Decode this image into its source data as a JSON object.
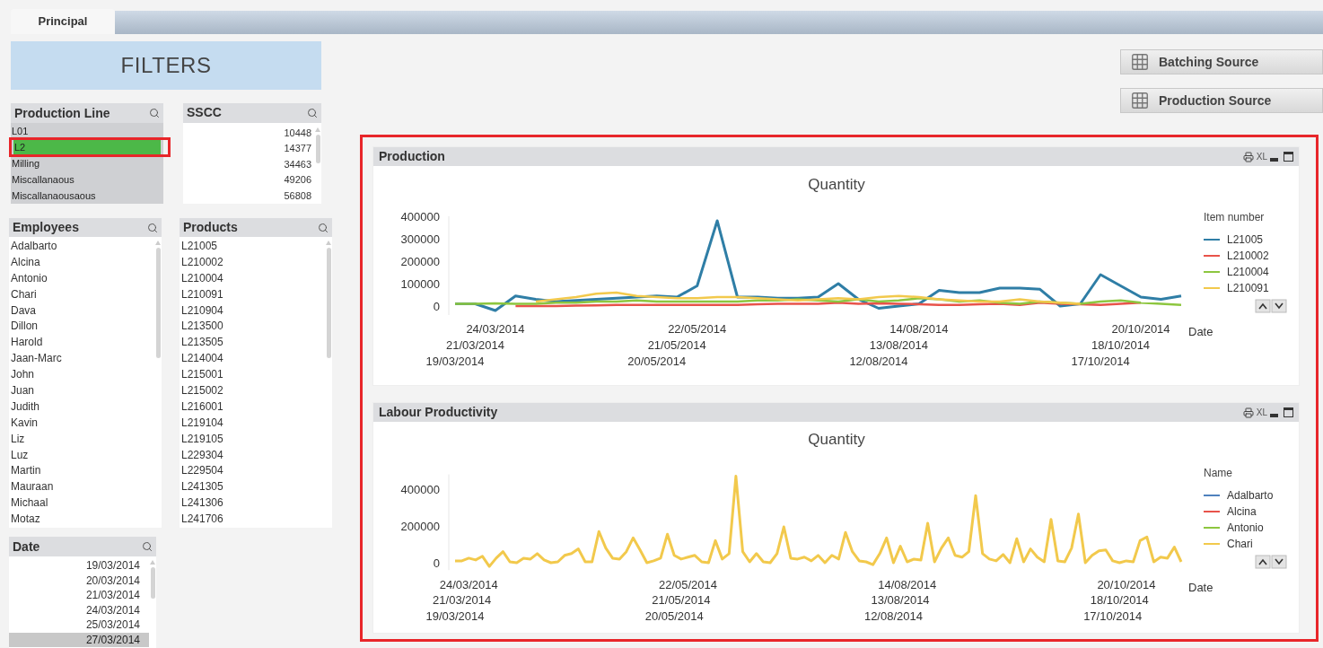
{
  "tabs": [
    {
      "label": "Principal",
      "selected": true
    }
  ],
  "filters_title": "FILTERS",
  "production_line": {
    "title": "Production Line",
    "items": [
      {
        "label": "L01",
        "selected": false
      },
      {
        "label": "L2",
        "selected": true
      },
      {
        "label": "Milling",
        "selected": false
      },
      {
        "label": "Miscallanaous",
        "selected": false
      },
      {
        "label": "Miscallanaousaous",
        "selected": false
      }
    ]
  },
  "sscc": {
    "title": "SSCC",
    "items": [
      "10448",
      "14377",
      "34463",
      "49206",
      "56808"
    ]
  },
  "employees": {
    "title": "Employees",
    "items": [
      "Adalbarto",
      "Alcina",
      "Antonio",
      "Chari",
      "Dava",
      "Dillon",
      "Harold",
      "Jaan-Marc",
      "John",
      "Juan",
      "Judith",
      "Kavin",
      "Liz",
      "Luz",
      "Martin",
      "Mauraan",
      "Michaal",
      "Motaz"
    ]
  },
  "products": {
    "title": "Products",
    "items": [
      "L21005",
      "L210002",
      "L210004",
      "L210091",
      "L210904",
      "L213500",
      "L213505",
      "L214004",
      "L215001",
      "L215002",
      "L216001",
      "L219104",
      "L219105",
      "L229304",
      "L229504",
      "L241305",
      "L241306",
      "L241706"
    ]
  },
  "date_list": {
    "title": "Date",
    "items": [
      {
        "label": "19/03/2014",
        "excluded": false
      },
      {
        "label": "20/03/2014",
        "excluded": false
      },
      {
        "label": "21/03/2014",
        "excluded": false
      },
      {
        "label": "24/03/2014",
        "excluded": false
      },
      {
        "label": "25/03/2014",
        "excluded": false
      },
      {
        "label": "27/03/2014",
        "excluded": true
      }
    ]
  },
  "source_buttons": [
    "Batching Source",
    "Production Source"
  ],
  "charts": [
    {
      "title": "Production",
      "tools": [
        "XL"
      ],
      "chart_data": {
        "type": "line",
        "title": "Quantity",
        "xlabel": "Date",
        "legend": {
          "title": "Item number"
        },
        "ylim": [
          -40000,
          400000
        ],
        "yticks": [
          0,
          100000,
          200000,
          300000,
          400000
        ],
        "categories": [
          "19/03/2014",
          "21/03/2014",
          "24/03/2014",
          null,
          null,
          null,
          null,
          null,
          null,
          null,
          "20/05/2014",
          "21/05/2014",
          "22/05/2014",
          null,
          null,
          null,
          null,
          null,
          null,
          null,
          null,
          "12/08/2014",
          "13/08/2014",
          "14/08/2014",
          null,
          null,
          null,
          null,
          null,
          null,
          null,
          null,
          "17/10/2014",
          "18/10/2014",
          "20/10/2014",
          null,
          null
        ],
        "series": [
          {
            "name": "L21005",
            "color": "#2f7ea6",
            "values": [
              10000,
              10000,
              -20000,
              45000,
              30000,
              20000,
              25000,
              30000,
              35000,
              40000,
              45000,
              40000,
              90000,
              380000,
              40000,
              40000,
              35000,
              35000,
              40000,
              100000,
              30000,
              -10000,
              0,
              10000,
              70000,
              60000,
              60000,
              80000,
              80000,
              75000,
              0,
              10000,
              140000,
              90000,
              40000,
              30000,
              45000
            ]
          },
          {
            "name": "L210002",
            "color": "#e8534a",
            "values": [
              null,
              null,
              null,
              0,
              0,
              0,
              2000,
              3000,
              5000,
              5000,
              5000,
              5000,
              5000,
              5000,
              5000,
              8000,
              10000,
              10000,
              10000,
              15000,
              10000,
              12000,
              10000,
              8000,
              5000,
              5000,
              8000,
              10000,
              5000,
              15000,
              10000,
              8000,
              5000,
              10000,
              15000,
              null,
              null
            ]
          },
          {
            "name": "L210004",
            "color": "#8dc63f",
            "values": [
              10000,
              10000,
              12000,
              10000,
              10000,
              15000,
              15000,
              20000,
              20000,
              25000,
              20000,
              20000,
              20000,
              20000,
              20000,
              25000,
              25000,
              30000,
              25000,
              20000,
              30000,
              20000,
              25000,
              35000,
              30000,
              20000,
              25000,
              15000,
              10000,
              20000,
              15000,
              10000,
              20000,
              25000,
              15000,
              10000,
              5000
            ]
          },
          {
            "name": "L210091",
            "color": "#f2c94c",
            "values": [
              null,
              null,
              null,
              null,
              20000,
              30000,
              40000,
              55000,
              60000,
              45000,
              40000,
              35000,
              35000,
              40000,
              40000,
              35000,
              30000,
              25000,
              30000,
              35000,
              30000,
              40000,
              45000,
              40000,
              30000,
              25000,
              20000,
              20000,
              30000,
              20000,
              15000,
              10000,
              null,
              null,
              null,
              null,
              null
            ]
          }
        ]
      }
    },
    {
      "title": "Labour Productivity",
      "tools": [
        "XL"
      ],
      "chart_data": {
        "type": "line",
        "title": "Quantity",
        "xlabel": "Date",
        "legend": {
          "title": "Name",
          "items": [
            {
              "name": "Adalbarto",
              "color": "#4f81bd"
            },
            {
              "name": "Alcina",
              "color": "#e8534a"
            },
            {
              "name": "Antonio",
              "color": "#8dc63f"
            }
          ]
        },
        "ylim": [
          -40000,
          480000
        ],
        "yticks": [
          0,
          200000,
          400000
        ],
        "categories": [
          "19/03/2014",
          "21/03/2014",
          "24/03/2014",
          null,
          null,
          null,
          null,
          null,
          null,
          null,
          null,
          null,
          null,
          null,
          null,
          null,
          null,
          null,
          null,
          null,
          null,
          null,
          null,
          null,
          null,
          null,
          null,
          null,
          null,
          null,
          null,
          null,
          "20/05/2014",
          "21/05/2014",
          "22/05/2014",
          null,
          null,
          null,
          null,
          null,
          null,
          null,
          null,
          null,
          null,
          null,
          null,
          null,
          null,
          null,
          null,
          null,
          null,
          null,
          null,
          null,
          null,
          null,
          null,
          null,
          null,
          null,
          null,
          null,
          "12/08/2014",
          "13/08/2014",
          "14/08/2014",
          null,
          null,
          null,
          null,
          null,
          null,
          null,
          null,
          null,
          null,
          null,
          null,
          null,
          null,
          null,
          null,
          null,
          null,
          null,
          null,
          null,
          null,
          null,
          null,
          null,
          null,
          null,
          null,
          null,
          "17/10/2014",
          "18/10/2014",
          "20/10/2014",
          null,
          null,
          null,
          null,
          null,
          null,
          null,
          null
        ],
        "series": [
          {
            "name": "Chari",
            "color": "#f2c94c",
            "values": [
              10000,
              10000,
              25000,
              15000,
              35000,
              -20000,
              25000,
              60000,
              5000,
              0,
              25000,
              20000,
              50000,
              15000,
              0,
              5000,
              40000,
              50000,
              75000,
              5000,
              5000,
              170000,
              80000,
              25000,
              20000,
              60000,
              135000,
              70000,
              0,
              10000,
              25000,
              155000,
              40000,
              20000,
              30000,
              40000,
              5000,
              0,
              120000,
              20000,
              50000,
              470000,
              60000,
              5000,
              50000,
              5000,
              0,
              50000,
              195000,
              25000,
              20000,
              30000,
              10000,
              40000,
              0,
              40000,
              20000,
              165000,
              60000,
              10000,
              5000,
              -10000,
              50000,
              135000,
              0,
              90000,
              5000,
              20000,
              15000,
              215000,
              5000,
              80000,
              135000,
              40000,
              30000,
              60000,
              365000,
              50000,
              20000,
              10000,
              45000,
              0,
              130000,
              5000,
              75000,
              30000,
              5000,
              235000,
              10000,
              5000,
              80000,
              265000,
              0,
              40000,
              65000,
              70000,
              10000,
              0,
              10000,
              5000,
              120000,
              140000,
              5000,
              30000,
              25000,
              85000,
              5000
            ]
          }
        ]
      }
    }
  ]
}
